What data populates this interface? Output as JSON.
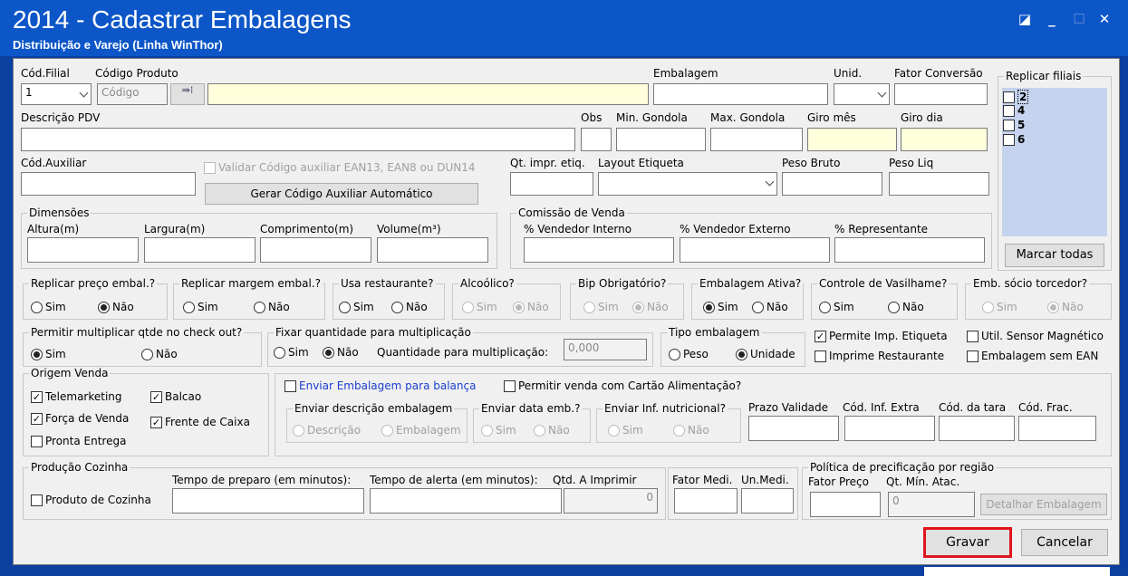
{
  "window": {
    "title": "2014 - Cadastrar Embalagens",
    "subtitle": "Distribuição e Varejo (Linha WinThor)"
  },
  "labels": {
    "cod_filial": "Cód.Filial",
    "codigo_produto": "Código Produto",
    "embalagem": "Embalagem",
    "unid": "Unid.",
    "fator_conversao": "Fator Conversão",
    "replicar_filiais": "Replicar filiais",
    "descricao_pdv": "Descrição PDV",
    "obs": "Obs",
    "min_gondola": "Min. Gondola",
    "max_gondola": "Max. Gondola",
    "giro_mes": "Giro mês",
    "giro_dia": "Giro dia",
    "cod_auxiliar": "Cód.Auxiliar",
    "validar_ean": "Validar Código auxiliar EAN13, EAN8 ou DUN14",
    "qt_impr_etiq": "Qt. impr. etiq.",
    "layout_etiqueta": "Layout Etiqueta",
    "peso_bruto": "Peso Bruto",
    "peso_liq": "Peso Liq",
    "dimensoes": "Dimensões",
    "altura": "Altura(m)",
    "largura": "Largura(m)",
    "comprimento": "Comprimento(m)",
    "volume": "Volume(m³)",
    "comissao": "Comissão de Venda",
    "vend_interno": "% Vendedor Interno",
    "vend_externo": "% Vendedor Externo",
    "representante": "% Representante",
    "permitir_mult": "Permitir multiplicar qtde no check out?",
    "fixar_qtd": "Fixar quantidade para multiplicação",
    "qtd_mult": "Quantidade para multiplicação:",
    "tipo_emb": "Tipo embalagem",
    "peso": "Peso",
    "unidade": "Unidade",
    "origem_venda": "Origem Venda",
    "enviar_desc_emb": "Enviar descrição embalagem",
    "descricao": "Descrição",
    "embalagem_opt": "Embalagem",
    "enviar_data_emb": "Enviar data emb.?",
    "enviar_inf_nutri": "Enviar Inf. nutricional?",
    "prazo_validade": "Prazo Validade",
    "cod_inf_extra": "Cód. Inf. Extra",
    "cod_tara": "Cód. da tara",
    "cod_frac": "Cód. Frac.",
    "producao_cozinha": "Produção Cozinha",
    "tempo_preparo": "Tempo de preparo (em minutos):",
    "tempo_alerta": "Tempo de alerta (em minutos):",
    "qtd_imprimir": "Qtd. A Imprimir",
    "fator_medi": "Fator Medi.",
    "un_medi": "Un.Medi.",
    "politica": "Política de precificação por região",
    "fator_preco": "Fator Preço",
    "qt_min_atac": "Qt. Mín. Atac.",
    "sim": "Sim",
    "nao": "Não"
  },
  "values": {
    "filial": "1",
    "codigo_placeholder": "Código",
    "qtd_mult": "0,000",
    "qtd_imprimir": "0",
    "qt_min_atac": "0"
  },
  "filiais": [
    "2",
    "4",
    "5",
    "6"
  ],
  "questions": {
    "q1": "Replicar preço embal.?",
    "q2": "Replicar margem embal.?",
    "q3": "Usa restaurante?",
    "q4": "Alcoólico?",
    "q5": "Bip Obrigatório?",
    "q6": "Embalagem Ativa?",
    "q7": "Controle de Vasilhame?",
    "q8": "Emb. sócio torcedor?"
  },
  "checks": {
    "permite_imp": "Permite Imp. Etiqueta",
    "util_sensor": "Util. Sensor Magnético",
    "imprime_rest": "Imprime Restaurante",
    "emb_sem_ean": "Embalagem sem EAN",
    "telemarketing": "Telemarketing",
    "balcao": "Balcao",
    "forca_venda": "Força de Venda",
    "frente_caixa": "Frente de Caixa",
    "pronta_entrega": "Pronta Entrega",
    "enviar_balanca": "Enviar Embalagem para balança",
    "cartao_alim": "Permitir venda com Cartão Alimentação?",
    "produto_cozinha": "Produto de Cozinha"
  },
  "buttons": {
    "gerar": "Gerar Código Auxiliar Automático",
    "marcar_todas": "Marcar todas",
    "detalhar": "Detalhar Embalagem",
    "gravar": "Gravar",
    "cancelar": "Cancelar"
  },
  "colors": {
    "title_bar": "#0c56c8",
    "highlight": "#e0141e",
    "filiais_bg": "#c5d3ee"
  }
}
